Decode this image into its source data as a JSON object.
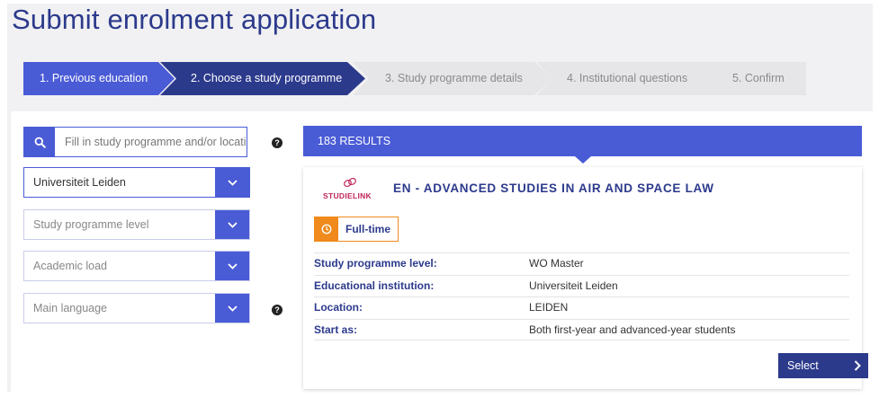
{
  "page": {
    "title": "Submit enrolment application"
  },
  "steps": [
    {
      "label": "1. Previous education",
      "state": "active"
    },
    {
      "label": "2. Choose a study programme",
      "state": "active"
    },
    {
      "label": "3. Study programme details",
      "state": "inactive"
    },
    {
      "label": "4. Institutional questions",
      "state": "inactive"
    },
    {
      "label": "5. Confirm",
      "state": "inactive"
    }
  ],
  "filters": {
    "search": {
      "placeholder": "Fill in study programme and/or location",
      "value": "",
      "icon": "search-icon"
    },
    "institution": {
      "value": "Universiteit Leiden"
    },
    "level": {
      "placeholder": "Study programme level"
    },
    "load": {
      "placeholder": "Academic load"
    },
    "language": {
      "placeholder": "Main language"
    }
  },
  "results": {
    "count_label": "183 RESULTS"
  },
  "programme": {
    "logo_text": "STUDIELINK",
    "title": "EN - ADVANCED STUDIES IN AIR AND SPACE LAW",
    "badge": "Full-time",
    "details": [
      {
        "key": "Study programme level:",
        "value": "WO Master"
      },
      {
        "key": "Educational institution:",
        "value": "Universiteit Leiden"
      },
      {
        "key": "Location:",
        "value": "LEIDEN"
      },
      {
        "key": "Start as:",
        "value": "Both first-year and advanced-year students"
      }
    ],
    "select_label": "Select"
  },
  "colors": {
    "primary": "#4a5bd6",
    "navy": "#2c3a8c",
    "step_inactive": "#e6e6e8",
    "badge_orange": "#f08a1c",
    "logo_pink": "#c0245b"
  }
}
